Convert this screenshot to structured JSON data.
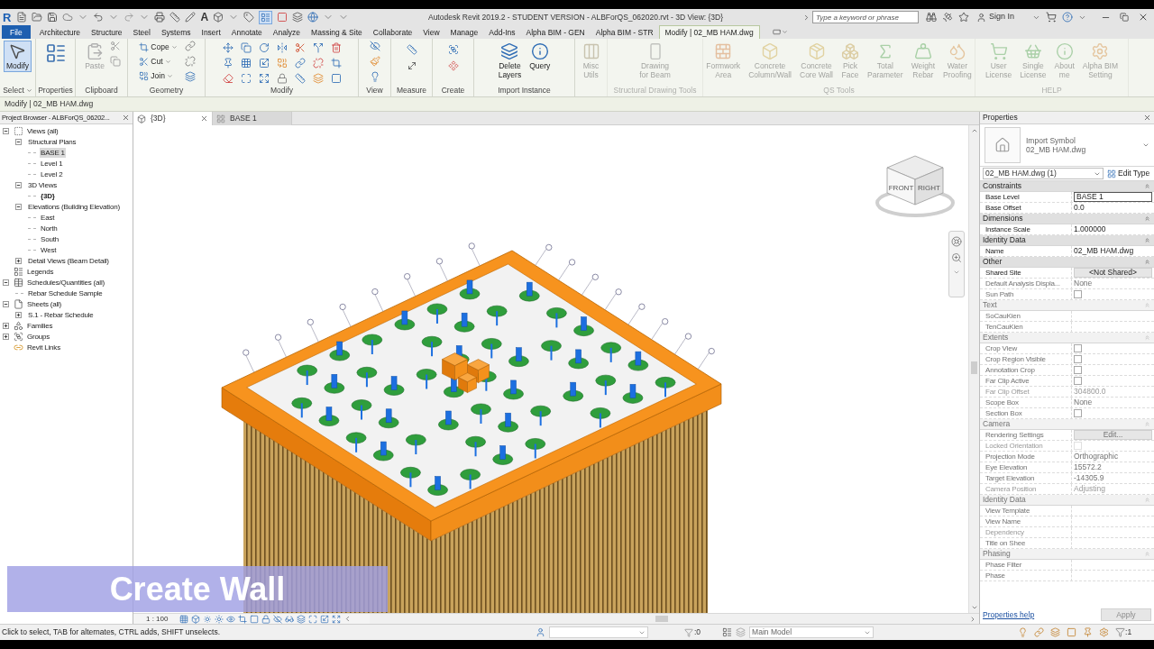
{
  "title_bar": {
    "logo": "R",
    "text_tool": "A",
    "title": "Autodesk Revit 2019.2 - STUDENT VERSION - ALBForQS_062020.rvt - 3D View: {3D}",
    "search": {
      "placeholder": "Type a keyword or phrase"
    },
    "sign_in": "Sign In"
  },
  "tabs": [
    {
      "label": "File",
      "kind": "file",
      "selected": false
    },
    {
      "label": "Architecture",
      "kind": "tab",
      "selected": false
    },
    {
      "label": "Structure",
      "kind": "tab",
      "selected": false
    },
    {
      "label": "Steel",
      "kind": "tab",
      "selected": false
    },
    {
      "label": "Systems",
      "kind": "tab",
      "selected": false
    },
    {
      "label": "Insert",
      "kind": "tab",
      "selected": false
    },
    {
      "label": "Annotate",
      "kind": "tab",
      "selected": false
    },
    {
      "label": "Analyze",
      "kind": "tab",
      "selected": false
    },
    {
      "label": "Massing & Site",
      "kind": "tab",
      "selected": false
    },
    {
      "label": "Collaborate",
      "kind": "tab",
      "selected": false
    },
    {
      "label": "View",
      "kind": "tab",
      "selected": false
    },
    {
      "label": "Manage",
      "kind": "tab",
      "selected": false
    },
    {
      "label": "Add-Ins",
      "kind": "tab",
      "selected": false
    },
    {
      "label": "Alpha BIM - GEN",
      "kind": "tab",
      "selected": false
    },
    {
      "label": "Alpha BIM - STR",
      "kind": "tab",
      "selected": false
    },
    {
      "label": "Modify | 02_MB HAM.dwg",
      "kind": "context",
      "selected": true
    }
  ],
  "ribbon": {
    "panels": [
      {
        "kind": "select",
        "label": "Select",
        "faded": false,
        "tools": [
          {
            "kind": "large",
            "label": "Modify",
            "selected": true,
            "disabled": false
          }
        ]
      },
      {
        "kind": "properties",
        "label": "Properties",
        "faded": false
      },
      {
        "kind": "clipboard",
        "label": "Clipboard",
        "faded": false,
        "tools": [
          {
            "kind": "large",
            "label": "Paste",
            "selected": false,
            "disabled": true
          }
        ]
      },
      {
        "kind": "geometry",
        "label": "Geometry",
        "faded": false,
        "tools": [
          {
            "kind": "small",
            "label": "Cope",
            "selected": false,
            "disabled": false
          },
          {
            "kind": "small",
            "label": "Cut",
            "selected": false,
            "disabled": false
          },
          {
            "kind": "small",
            "label": "Join",
            "selected": false,
            "disabled": false
          }
        ]
      },
      {
        "kind": "modify",
        "label": "Modify",
        "faded": false
      },
      {
        "kind": "view",
        "label": "View",
        "faded": false
      },
      {
        "kind": "measure",
        "label": "Measure",
        "faded": false
      },
      {
        "kind": "create",
        "label": "Create",
        "faded": false
      },
      {
        "kind": "import",
        "label": "Import Instance",
        "faded": false,
        "tools": [
          {
            "kind": "large",
            "label": "Delete\nLayers",
            "selected": false,
            "disabled": false
          },
          {
            "kind": "large",
            "label": "Query",
            "selected": false,
            "disabled": false
          }
        ]
      },
      {
        "kind": "misc",
        "faded": true,
        "tools": [
          {
            "kind": "large",
            "label": "Misc\nUtils",
            "selected": false,
            "disabled": false
          }
        ]
      },
      {
        "kind": "drawing",
        "label": "Structural Drawing Tools",
        "faded": true,
        "tools": [
          {
            "kind": "large",
            "label": "Drawing\nfor Beam",
            "selected": false,
            "disabled": false
          }
        ]
      },
      {
        "kind": "qs",
        "label": "QS Tools",
        "faded": true,
        "tools": [
          {
            "kind": "large",
            "label": "Formwork\nArea",
            "selected": false,
            "disabled": false
          },
          {
            "kind": "large",
            "label": "Concrete\nColumn/Wall",
            "selected": false,
            "disabled": false
          },
          {
            "kind": "large",
            "label": "Concrete\nCore Wall",
            "selected": false,
            "disabled": false
          },
          {
            "kind": "large",
            "label": "Pick\nFace",
            "selected": false,
            "disabled": false
          },
          {
            "kind": "large",
            "label": "Total\nParameter",
            "selected": false,
            "disabled": false
          },
          {
            "kind": "large",
            "label": "Weight\nRebar",
            "selected": false,
            "disabled": false
          },
          {
            "kind": "large",
            "label": "Water\nProofing",
            "selected": false,
            "disabled": false
          }
        ]
      },
      {
        "kind": "help",
        "label": "HELP",
        "faded": true,
        "tools": [
          {
            "kind": "large",
            "label": "User\nLicense",
            "selected": false,
            "disabled": false
          },
          {
            "kind": "large",
            "label": "Single\nLicense",
            "selected": false,
            "disabled": false
          },
          {
            "kind": "large",
            "label": "About\nme",
            "selected": false,
            "disabled": false
          },
          {
            "kind": "large",
            "label": "Alpha BIM\nSetting",
            "selected": false,
            "disabled": false
          }
        ]
      }
    ]
  },
  "options_bar": {
    "label": "Modify | 02_MB HAM.dwg"
  },
  "project_browser": {
    "title": "Project Browser - ALBForQS_06202...",
    "tree": [
      {
        "label": "Views (all)",
        "kind": "views",
        "expanded": true,
        "selected": false,
        "current": false,
        "children": [
          {
            "label": "Structural Plans",
            "expanded": true,
            "selected": false,
            "current": false,
            "children": [
              {
                "label": "BASE 1",
                "selected": true,
                "current": false
              },
              {
                "label": "Level 1",
                "selected": false,
                "current": false
              },
              {
                "label": "Level 2",
                "selected": false,
                "current": false
              }
            ]
          },
          {
            "label": "3D Views",
            "expanded": true,
            "selected": false,
            "current": false,
            "children": [
              {
                "label": "{3D}",
                "selected": false,
                "current": true
              }
            ]
          },
          {
            "label": "Elevations (Building Elevation)",
            "expanded": true,
            "selected": false,
            "current": false,
            "children": [
              {
                "label": "East",
                "selected": false,
                "current": false
              },
              {
                "label": "North",
                "selected": false,
                "current": false
              },
              {
                "label": "South",
                "selected": false,
                "current": false
              },
              {
                "label": "West",
                "selected": false,
                "current": false
              }
            ]
          },
          {
            "label": "Detail Views (Beam Detail)",
            "expanded": false,
            "selected": false,
            "current": false
          }
        ]
      },
      {
        "label": "Legends",
        "kind": "legends",
        "selected": false,
        "current": false
      },
      {
        "label": "Schedules/Quantities (all)",
        "kind": "schedules",
        "expanded": true,
        "selected": false,
        "current": false,
        "children": [
          {
            "label": "Rebar Schedule Sample",
            "selected": false,
            "current": false
          }
        ]
      },
      {
        "label": "Sheets (all)",
        "kind": "sheets",
        "expanded": true,
        "selected": false,
        "current": false,
        "children": [
          {
            "label": "S.1 - Rebar Schedule",
            "expanded": false,
            "selected": false,
            "current": false
          }
        ]
      },
      {
        "label": "Families",
        "kind": "families",
        "expanded": false,
        "selected": false,
        "current": false
      },
      {
        "label": "Groups",
        "kind": "groups",
        "expanded": false,
        "selected": false,
        "current": false
      },
      {
        "label": "Revit Links",
        "kind": "links",
        "selected": false,
        "current": false
      }
    ]
  },
  "view_tabs": [
    {
      "label": "{3D}",
      "kind": "model",
      "selected": true
    },
    {
      "label": "BASE 1",
      "kind": "plan",
      "selected": false
    }
  ],
  "viewport": {
    "view_cube": {
      "faces": [
        "FRONT",
        "RIGHT"
      ]
    },
    "scale": "1 : 100"
  },
  "properties": {
    "title": "Properties",
    "type_family": "Import Symbol",
    "type_name": "02_MB HAM.dwg",
    "instance_selector": "02_MB HAM.dwg (1)",
    "edit_type": "Edit Type",
    "rows": [
      {
        "kind": "section",
        "label": "Constraints",
        "faded": false,
        "disabled": false
      },
      {
        "kind": "field",
        "label": "Base Level",
        "value": "BASE 1",
        "faded": false,
        "disabled": false
      },
      {
        "kind": "text",
        "label": "Base Offset",
        "value": "0.0",
        "faded": false,
        "disabled": false
      },
      {
        "kind": "section",
        "label": "Dimensions",
        "faded": false,
        "disabled": false
      },
      {
        "kind": "text",
        "label": "Instance Scale",
        "value": "1.000000",
        "faded": false,
        "disabled": false
      },
      {
        "kind": "section",
        "label": "Identity Data",
        "faded": false,
        "disabled": false
      },
      {
        "kind": "text",
        "label": "Name",
        "value": "02_MB HAM.dwg",
        "faded": false,
        "disabled": false
      },
      {
        "kind": "section",
        "label": "Other",
        "faded": false,
        "disabled": false
      },
      {
        "kind": "button",
        "label": "Shared Site",
        "value": "<Not Shared>",
        "faded": false,
        "disabled": false
      },
      {
        "kind": "text",
        "label": "Default Analysis Displa...",
        "value": "None",
        "faded": true,
        "disabled": false
      },
      {
        "kind": "check",
        "label": "Sun Path",
        "checked": false,
        "faded": true,
        "disabled": false
      },
      {
        "kind": "section",
        "label": "Text",
        "faded": true,
        "disabled": false
      },
      {
        "kind": "text",
        "label": "SoCauKien",
        "faded": true,
        "disabled": false
      },
      {
        "kind": "text",
        "label": "TenCauKien",
        "faded": true,
        "disabled": false
      },
      {
        "kind": "section",
        "label": "Extents",
        "faded": true,
        "disabled": false
      },
      {
        "kind": "check",
        "label": "Crop View",
        "checked": false,
        "faded": true,
        "disabled": false
      },
      {
        "kind": "check",
        "label": "Crop Region Visible",
        "checked": false,
        "faded": true,
        "disabled": false
      },
      {
        "kind": "check",
        "label": "Annotation Crop",
        "checked": false,
        "faded": true,
        "disabled": false
      },
      {
        "kind": "check",
        "label": "Far Clip Active",
        "checked": false,
        "faded": true,
        "disabled": false
      },
      {
        "kind": "text",
        "label": "Far Clip Offset",
        "value": "304800.0",
        "faded": true,
        "disabled": true
      },
      {
        "kind": "text",
        "label": "Scope Box",
        "value": "None",
        "faded": true,
        "disabled": false
      },
      {
        "kind": "check",
        "label": "Section Box",
        "checked": false,
        "faded": true,
        "disabled": false
      },
      {
        "kind": "section",
        "label": "Camera",
        "faded": true,
        "disabled": false
      },
      {
        "kind": "button",
        "label": "Rendering Settings",
        "value": "Edit...",
        "faded": true,
        "disabled": false
      },
      {
        "kind": "check",
        "label": "Locked Orientation",
        "checked": false,
        "faded": true,
        "disabled": true
      },
      {
        "kind": "text",
        "label": "Projection Mode",
        "value": "Orthographic",
        "faded": true,
        "disabled": false
      },
      {
        "kind": "text",
        "label": "Eye Elevation",
        "value": "15572.2",
        "faded": true,
        "disabled": false
      },
      {
        "kind": "text",
        "label": "Target Elevation",
        "value": "-14305.9",
        "faded": true,
        "disabled": false
      },
      {
        "kind": "text",
        "label": "Camera Position",
        "value": "Adjusting",
        "faded": true,
        "disabled": true
      },
      {
        "kind": "section",
        "label": "Identity Data",
        "faded": true,
        "disabled": false
      },
      {
        "kind": "text",
        "label": "View Template",
        "faded": true,
        "disabled": false
      },
      {
        "kind": "text",
        "label": "View Name",
        "faded": true,
        "disabled": false
      },
      {
        "kind": "text",
        "label": "Dependency",
        "faded": true,
        "disabled": true
      },
      {
        "kind": "text",
        "label": "Title on Shee",
        "faded": true,
        "disabled": false
      },
      {
        "kind": "section",
        "label": "Phasing",
        "faded": true,
        "disabled": false
      },
      {
        "kind": "text",
        "label": "Phase Filter",
        "faded": true,
        "disabled": false
      },
      {
        "kind": "text",
        "label": "Phase",
        "faded": true,
        "disabled": false
      }
    ],
    "help": "Properties help",
    "apply": {
      "label": "Apply",
      "disabled": true
    }
  },
  "status_bar": {
    "message": "Click to select, TAB for alternates, CTRL adds, SHIFT unselects.",
    "filter_count": ":0",
    "model": "Main Model",
    "selection_count": ":1"
  },
  "video_caption": "Create Wall"
}
